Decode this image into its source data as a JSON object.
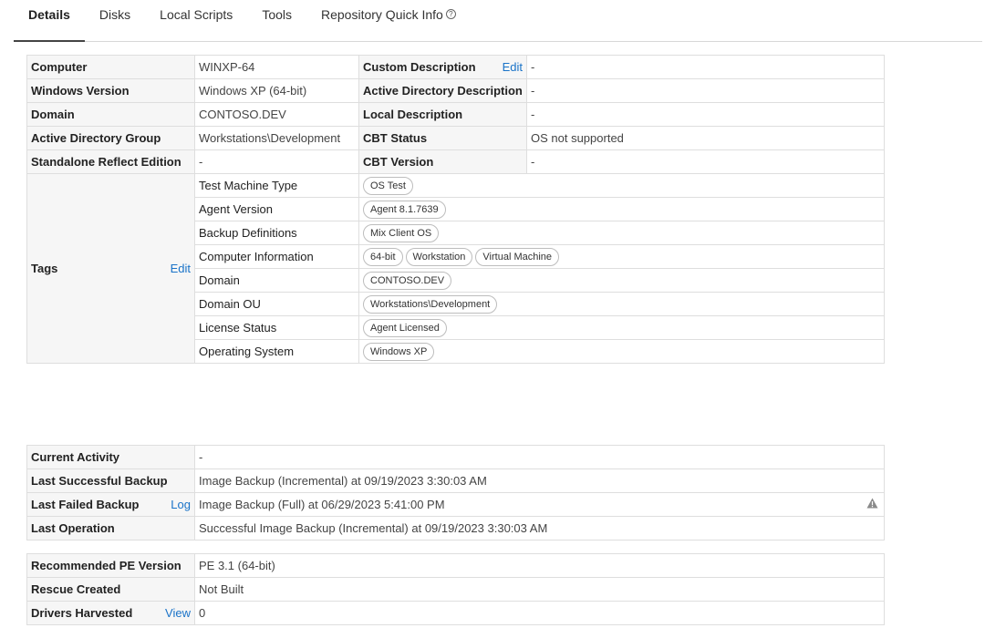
{
  "tabs": [
    {
      "label": "Details",
      "active": true
    },
    {
      "label": "Disks"
    },
    {
      "label": "Local Scripts"
    },
    {
      "label": "Tools"
    },
    {
      "label": "Repository Quick Info"
    }
  ],
  "details": {
    "computer": {
      "label": "Computer",
      "value": "WINXP-64"
    },
    "windows_version": {
      "label": "Windows Version",
      "value": "Windows XP (64-bit)"
    },
    "domain": {
      "label": "Domain",
      "value": "CONTOSO.DEV"
    },
    "ad_group": {
      "label": "Active Directory Group",
      "value": "Workstations\\Development"
    },
    "standalone": {
      "label": "Standalone Reflect Edition",
      "value": "-"
    },
    "custom_desc": {
      "label": "Custom Description",
      "edit": "Edit",
      "value": "-"
    },
    "ad_desc": {
      "label": "Active Directory Description",
      "value": "-"
    },
    "local_desc": {
      "label": "Local Description",
      "value": "-"
    },
    "cbt_status": {
      "label": "CBT Status",
      "value": "OS not supported"
    },
    "cbt_version": {
      "label": "CBT Version",
      "value": "-"
    }
  },
  "tags": {
    "label": "Tags",
    "edit": "Edit",
    "rows": [
      {
        "name": "Test Machine Type",
        "chips": [
          "OS Test"
        ]
      },
      {
        "name": "Agent Version",
        "chips": [
          "Agent 8.1.7639"
        ]
      },
      {
        "name": "Backup Definitions",
        "chips": [
          "Mix Client OS"
        ]
      },
      {
        "name": "Computer Information",
        "chips": [
          "64-bit",
          "Workstation",
          "Virtual Machine"
        ]
      },
      {
        "name": "Domain",
        "chips": [
          "CONTOSO.DEV"
        ]
      },
      {
        "name": "Domain OU",
        "chips": [
          "Workstations\\Development"
        ]
      },
      {
        "name": "License Status",
        "chips": [
          "Agent Licensed"
        ]
      },
      {
        "name": "Operating System",
        "chips": [
          "Windows XP"
        ]
      }
    ]
  },
  "activity": {
    "current": {
      "label": "Current Activity",
      "value": "-"
    },
    "last_success": {
      "label": "Last Successful Backup",
      "value": "Image Backup (Incremental) at 09/19/2023 3:30:03 AM"
    },
    "last_failed": {
      "label": "Last Failed Backup",
      "link": "Log",
      "value": "Image Backup (Full) at 06/29/2023 5:41:00 PM"
    },
    "last_op": {
      "label": "Last Operation",
      "value": "Successful Image Backup (Incremental) at 09/19/2023 3:30:03 AM"
    }
  },
  "rescue": {
    "pe_version": {
      "label": "Recommended PE Version",
      "value": "PE 3.1 (64-bit)"
    },
    "rescue_created": {
      "label": "Rescue Created",
      "value": "Not Built"
    },
    "drivers": {
      "label": "Drivers Harvested",
      "link": "View",
      "value": "0"
    }
  },
  "icons": {
    "help": "question-circle-icon",
    "warning": "warning-triangle-icon"
  },
  "colors": {
    "link": "#1a73c8",
    "label_bg": "#f6f6f6"
  }
}
